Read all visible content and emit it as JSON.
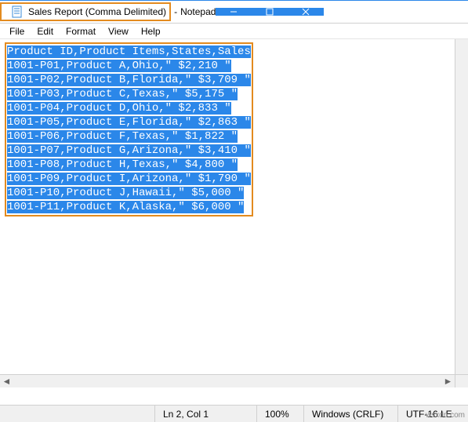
{
  "titlebar": {
    "filename": "Sales Report (Comma Delimited)",
    "appname": "Notepad",
    "separator": " - "
  },
  "menu": {
    "file": "File",
    "edit": "Edit",
    "format": "Format",
    "view": "View",
    "help": "Help"
  },
  "text_lines": [
    "Product ID,Product Items,States,Sales",
    "1001-P01,Product A,Ohio,\" $2,210 \"",
    "1001-P02,Product B,Florida,\" $3,709 \"",
    "1001-P03,Product C,Texas,\" $5,175 \"",
    "1001-P04,Product D,Ohio,\" $2,833 \"",
    "1001-P05,Product E,Florida,\" $2,863 \"",
    "1001-P06,Product F,Texas,\" $1,822 \"",
    "1001-P07,Product G,Arizona,\" $3,410 \"",
    "1001-P08,Product H,Texas,\" $4,800 \"",
    "1001-P09,Product I,Arizona,\" $1,790 \"",
    "1001-P10,Product J,Hawaii,\" $5,000 \"",
    "1001-P11,Product K,Alaska,\" $6,000 \""
  ],
  "statusbar": {
    "position": "Ln 2, Col 1",
    "zoom": "100%",
    "line_ending": "Windows (CRLF)",
    "encoding": "UTF-16 LE"
  },
  "watermark": "wsxdn.com",
  "colors": {
    "selection_bg": "#2b87e9",
    "highlight_border": "#e38b1f"
  }
}
